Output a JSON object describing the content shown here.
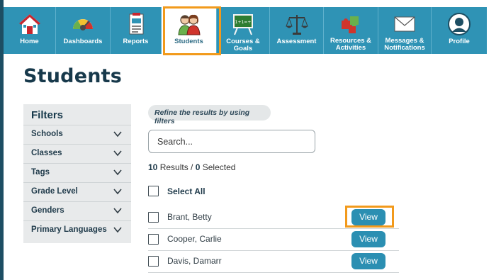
{
  "nav": {
    "items": [
      {
        "label": "Home",
        "icon": "house-icon",
        "lines": 1
      },
      {
        "label": "Dashboards",
        "icon": "gauge-icon",
        "lines": 1
      },
      {
        "label": "Reports",
        "icon": "report-icon",
        "lines": 1
      },
      {
        "label": "Students",
        "icon": "students-icon",
        "lines": 1,
        "active": true
      },
      {
        "label": "Courses & Goals",
        "icon": "chalkboard-icon",
        "lines": 1
      },
      {
        "label": "Assessment",
        "icon": "scales-icon",
        "lines": 1
      },
      {
        "label": "Resources & Activities",
        "line1": "Resources &",
        "line2": "Activities",
        "icon": "puzzle-icon",
        "lines": 2
      },
      {
        "label": "Messages & Notifications",
        "line1": "Messages &",
        "line2": "Notifications",
        "icon": "envelope-icon",
        "lines": 2
      },
      {
        "label": "Profile",
        "icon": "profile-icon",
        "lines": 1
      }
    ]
  },
  "page": {
    "title": "Students"
  },
  "filters": {
    "title": "Filters",
    "items": [
      "Schools",
      "Classes",
      "Tags",
      "Grade Level",
      "Genders",
      "Primary Languages"
    ]
  },
  "refine_text": "Refine the results by using filters",
  "search": {
    "placeholder": "Search..."
  },
  "results": {
    "count": "10",
    "results_label": " Results / ",
    "selected": "0",
    "selected_label": " Selected"
  },
  "select_all_label": "Select All",
  "students": [
    {
      "name": "Brant, Betty",
      "action": "View"
    },
    {
      "name": "Cooper, Carlie",
      "action": "View"
    },
    {
      "name": "Davis, Damarr",
      "action": "View"
    }
  ],
  "colors": {
    "nav_bg": "#2f93b5",
    "highlight": "#f29a1c",
    "button": "#2b8fb2",
    "title": "#17394b"
  }
}
